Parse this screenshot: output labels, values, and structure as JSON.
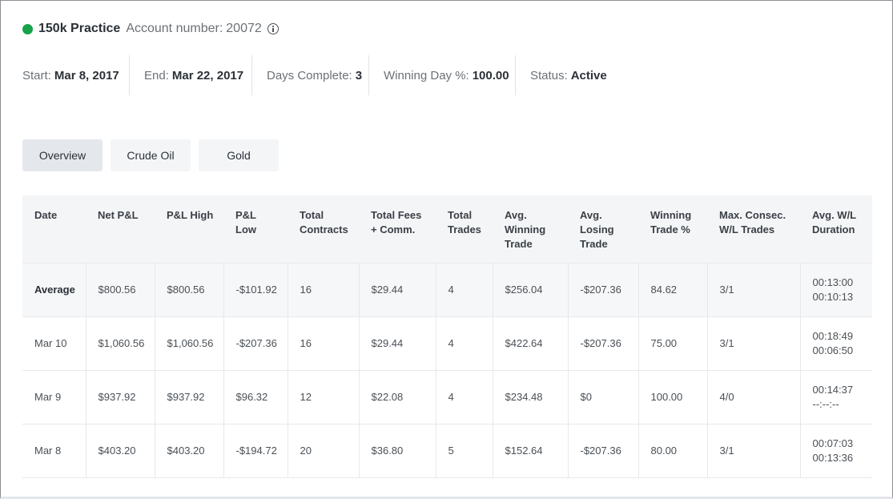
{
  "account": {
    "name": "150k Practice",
    "number_label": "Account number:",
    "number": "20072",
    "status_color": "#16a34a"
  },
  "stats": [
    {
      "label": "Start:",
      "value": "Mar 8, 2017"
    },
    {
      "label": "End:",
      "value": "Mar 22, 2017"
    },
    {
      "label": "Days Complete:",
      "value": "3"
    },
    {
      "label": "Winning Day %:",
      "value": "100.00"
    },
    {
      "label": "Status:",
      "value": "Active"
    }
  ],
  "tabs": [
    {
      "label": "Overview",
      "active": true
    },
    {
      "label": "Crude Oil",
      "active": false
    },
    {
      "label": "Gold",
      "active": false
    }
  ],
  "table": {
    "headers": [
      [
        "Date"
      ],
      [
        "Net P&L"
      ],
      [
        "P&L High"
      ],
      [
        "P&L",
        "Low"
      ],
      [
        "Total",
        "Contracts"
      ],
      [
        "Total Fees",
        "+ Comm."
      ],
      [
        "Total",
        "Trades"
      ],
      [
        "Avg.",
        "Winning",
        "Trade"
      ],
      [
        "Avg.",
        "Losing",
        "Trade"
      ],
      [
        "Winning",
        "Trade %"
      ],
      [
        "Max. Consec.",
        "W/L Trades"
      ],
      [
        "Avg. W/L",
        "Duration"
      ]
    ],
    "rows": [
      {
        "date": "Average",
        "net": "$800.56",
        "high": "$800.56",
        "low": "-$101.92",
        "contracts": "16",
        "fees": "$29.44",
        "trades": "4",
        "avg_win": "$256.04",
        "avg_loss": "-$207.36",
        "win_pct": "84.62",
        "consec": "3/1",
        "dur_w": "00:13:00",
        "dur_l": "00:10:13"
      },
      {
        "date": "Mar 10",
        "net": "$1,060.56",
        "high": "$1,060.56",
        "low": "-$207.36",
        "contracts": "16",
        "fees": "$29.44",
        "trades": "4",
        "avg_win": "$422.64",
        "avg_loss": "-$207.36",
        "win_pct": "75.00",
        "consec": "3/1",
        "dur_w": "00:18:49",
        "dur_l": "00:06:50"
      },
      {
        "date": "Mar 9",
        "net": "$937.92",
        "high": "$937.92",
        "low": "$96.32",
        "contracts": "12",
        "fees": "$22.08",
        "trades": "4",
        "avg_win": "$234.48",
        "avg_loss": "$0",
        "win_pct": "100.00",
        "consec": "4/0",
        "dur_w": "00:14:37",
        "dur_l": "--:--:--"
      },
      {
        "date": "Mar 8",
        "net": "$403.20",
        "high": "$403.20",
        "low": "-$194.72",
        "contracts": "20",
        "fees": "$36.80",
        "trades": "5",
        "avg_win": "$152.64",
        "avg_loss": "-$207.36",
        "win_pct": "80.00",
        "consec": "3/1",
        "dur_w": "00:07:03",
        "dur_l": "00:13:36"
      }
    ]
  }
}
